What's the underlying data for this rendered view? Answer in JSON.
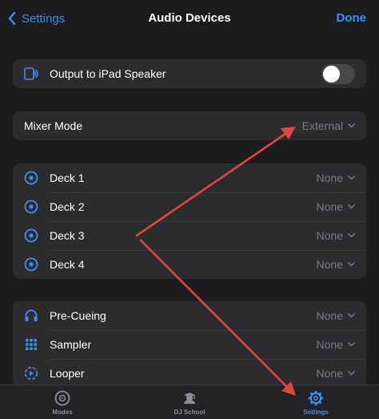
{
  "nav": {
    "back_label": "Settings",
    "title": "Audio Devices",
    "done_label": "Done"
  },
  "speaker": {
    "label": "Output to iPad Speaker",
    "icon": "ipad-speaker-icon",
    "toggle_on": false
  },
  "mixer": {
    "label": "Mixer Mode",
    "value": "External"
  },
  "decks": [
    {
      "label": "Deck 1",
      "value": "None",
      "icon": "deck-icon"
    },
    {
      "label": "Deck 2",
      "value": "None",
      "icon": "deck-icon"
    },
    {
      "label": "Deck 3",
      "value": "None",
      "icon": "deck-icon"
    },
    {
      "label": "Deck 4",
      "value": "None",
      "icon": "deck-icon"
    }
  ],
  "extras": [
    {
      "label": "Pre-Cueing",
      "value": "None",
      "icon": "headphones-icon"
    },
    {
      "label": "Sampler",
      "value": "None",
      "icon": "sampler-grid-icon"
    },
    {
      "label": "Looper",
      "value": "None",
      "icon": "looper-icon"
    }
  ],
  "tabs": [
    {
      "label": "Modes",
      "icon": "modes-icon",
      "active": false
    },
    {
      "label": "DJ School",
      "icon": "dj-school-icon",
      "active": false
    },
    {
      "label": "Settings",
      "icon": "gear-icon",
      "active": true
    }
  ],
  "colors": {
    "accent": "#3a8ff5",
    "background": "#1c1c1e",
    "cell": "#2c2c2e",
    "annotation_arrow": "#e0483e"
  }
}
